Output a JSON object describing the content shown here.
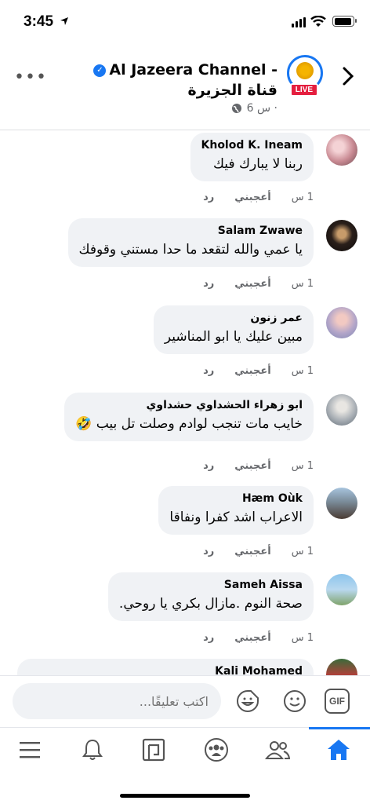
{
  "status_bar": {
    "time": "3:45"
  },
  "header": {
    "title": "Al Jazeera Channel - قناة الجزيرة",
    "live_badge": "LIVE",
    "post_time": "6 س ·"
  },
  "comments": [
    {
      "name": "Kholod K. Ineam",
      "text": "ربنا لا يبارك فيك",
      "time": "1 س",
      "like": "أعجبني",
      "reply": "رد"
    },
    {
      "name": "Salam Zwawe",
      "text": "يا عمي والله لتقعد ما حدا مستني وقوفك",
      "time": "1 س",
      "like": "أعجبني",
      "reply": "رد"
    },
    {
      "name": "عمر زنون",
      "text": "مبين عليك يا ابو المناشير",
      "time": "1 س",
      "like": "أعجبني",
      "reply": "رد"
    },
    {
      "name": "ابو زهراء الحشداوي  حشداوي",
      "text": "خايب مات تنجب لوادم وصلت  تل بيب 🤣",
      "time": "1 س",
      "like": "أعجبني",
      "reply": "رد"
    },
    {
      "name": "Hæm Oùk",
      "text": "الاعراب اشد كفرا ونفاقا",
      "time": "1 س",
      "like": "أعجبني",
      "reply": "رد"
    },
    {
      "name": "Sameh Aissa",
      "text": "صحة النوم .مازال بكري يا روحي.",
      "time": "1 س",
      "like": "أعجبني",
      "reply": "رد"
    },
    {
      "name": "Kali Mohamed",
      "text": "",
      "time": "",
      "like": "",
      "reply": ""
    }
  ],
  "composer": {
    "placeholder": "اكتب تعليقًا...",
    "gif_label": "GIF"
  },
  "tabs": [
    "menu",
    "notifications",
    "pages",
    "groups",
    "friends",
    "home"
  ],
  "colors": {
    "accent": "#1877f2",
    "live": "#e41e3f",
    "bubble": "#f0f2f5",
    "meta": "#65676b"
  }
}
